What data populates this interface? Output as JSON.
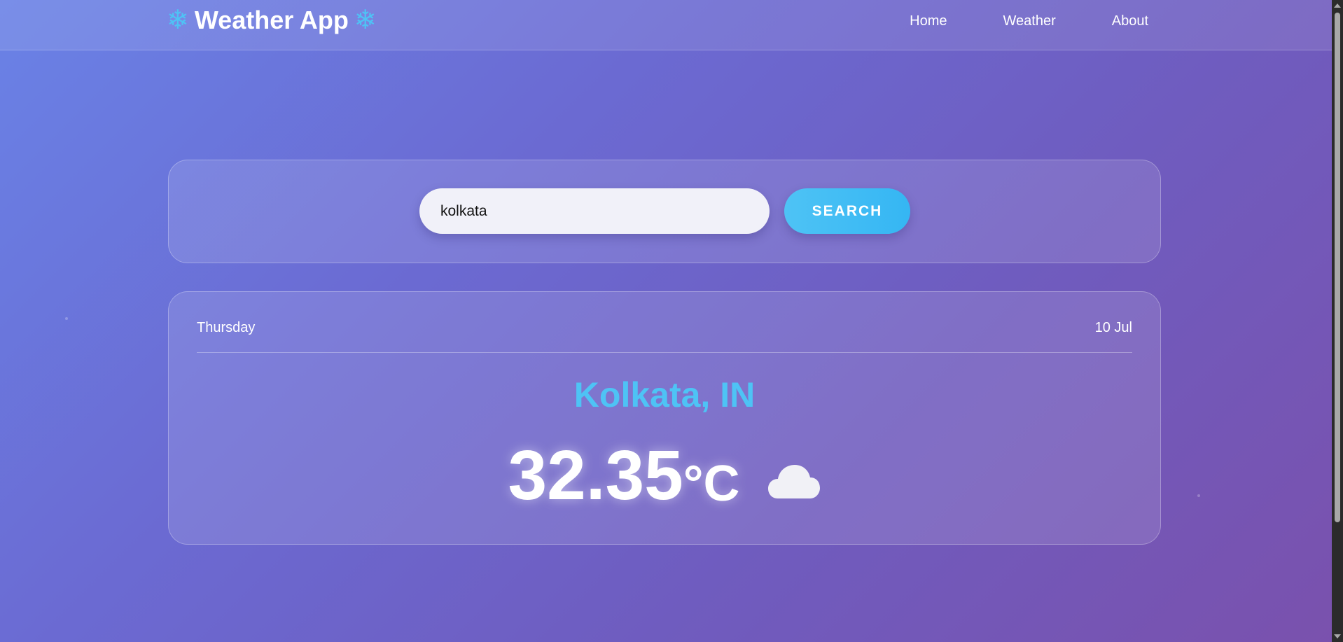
{
  "header": {
    "brand_icon_left": "❄",
    "brand_title": "Weather App",
    "brand_icon_right": "❄",
    "nav": [
      {
        "label": "Home"
      },
      {
        "label": "Weather"
      },
      {
        "label": "About"
      }
    ]
  },
  "search": {
    "value": "kolkata",
    "button_label": "SEARCH"
  },
  "weather": {
    "day": "Thursday",
    "date": "10 Jul",
    "city": "Kolkata, IN",
    "temperature": "32.35",
    "unit": "°C",
    "condition_icon": "cloud-icon"
  },
  "colors": {
    "accent": "#4ec3f5",
    "background_start": "#6a82e6",
    "background_end": "#7a51ad"
  }
}
